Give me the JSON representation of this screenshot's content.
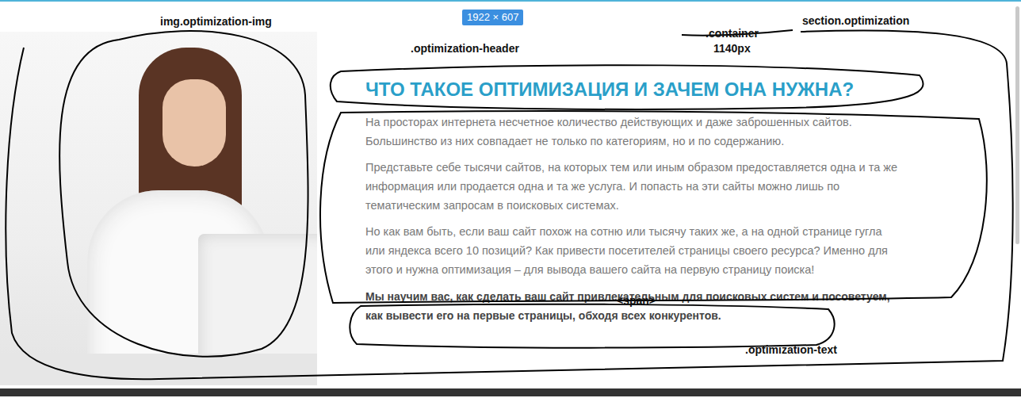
{
  "annotations": {
    "size_badge": "1922 × 607",
    "labels": [
      {
        "text": "img.optimization-img"
      },
      {
        "text": ".container"
      },
      {
        "text": "1140px"
      },
      {
        "text": "section.optimization"
      },
      {
        "text": ".optimization-header"
      },
      {
        "text": "<span>"
      },
      {
        "text": ".optimization-text"
      }
    ]
  },
  "section": {
    "header": "ЧТО ТАКОЕ ОПТИМИЗАЦИЯ И ЗАЧЕМ ОНА НУЖНА?",
    "paragraphs": [
      "На просторах интернета несчетное количество действующих и даже заброшенных сайтов. Большинство из них совпадает не только по категориям, но и по содержанию.",
      "Представьте себе тысячи сайтов, на которых тем или иным образом предоставляется одна и та же информация или продается одна и та же услуга. И попасть на эти сайты можно лишь по тематическим запросам в поисковых системах.",
      "Но как вам быть, если ваш сайт похож на сотню или тысячу таких же, а на одной странице гугла или яндекса всего 10 позиций? Как привести посетителей страницы своего ресурса? Именно для этого и нужна оптимизация – для вывода вашего сайта на первую страницу поиска!"
    ],
    "highlight": "Мы научим вас, как сделать ваш сайт привлекательным для поисковых систем и посоветуем, как вывести его на первые страницы, обходя всех конкурентов."
  }
}
